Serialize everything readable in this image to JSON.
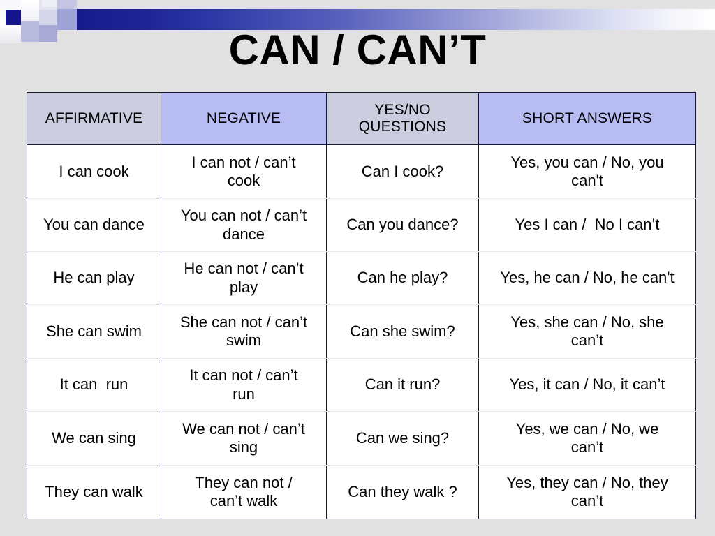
{
  "slide": {
    "title": "CAN / CAN’T",
    "background_color": "#e1e1e1",
    "accent_color": "#14148c"
  },
  "decor": {
    "band_name": "gradient-band",
    "gradient_from": "#151b8d",
    "gradient_to": "#ffffff"
  },
  "table": {
    "headers": [
      {
        "label": "AFFIRMATIVE",
        "color": "#ccccdf"
      },
      {
        "label": "NEGATIVE",
        "color": "#b7bcf3"
      },
      {
        "label": "YES/NO\nQUESTIONS",
        "color": "#ccccdf"
      },
      {
        "label": "SHORT ANSWERS",
        "color": "#b7bcf3"
      }
    ],
    "rows": [
      {
        "affirmative": "I can cook",
        "negative": "I can not  / can’t\ncook",
        "question": "Can I cook?",
        "short_answer": "Yes, you can / No, you\ncan't"
      },
      {
        "affirmative": "You can dance",
        "negative": "You can not / can’t\ndance",
        "question": "Can you dance?",
        "short_answer": "Yes I can /  No I can’t"
      },
      {
        "affirmative": "He can play",
        "negative": "He can not / can’t\nplay",
        "question": "Can he play?",
        "short_answer": "Yes, he can / No, he can't"
      },
      {
        "affirmative": "She can swim",
        "negative": "She can not / can’t\nswim",
        "question": "Can she swim?",
        "short_answer": "Yes, she can / No, she\ncan’t"
      },
      {
        "affirmative": "It can  run",
        "negative": "It can not / can’t\nrun",
        "question": "Can it run?",
        "short_answer": "Yes, it can / No, it can’t"
      },
      {
        "affirmative": "We can sing",
        "negative": "We can not / can’t\nsing",
        "question": "Can we sing?",
        "short_answer": "Yes, we can / No, we\ncan’t"
      },
      {
        "affirmative": "They can walk",
        "negative": "They can not /\ncan’t walk",
        "question": "Can they walk ?",
        "short_answer": "Yes, they can / No, they\ncan’t"
      }
    ]
  }
}
